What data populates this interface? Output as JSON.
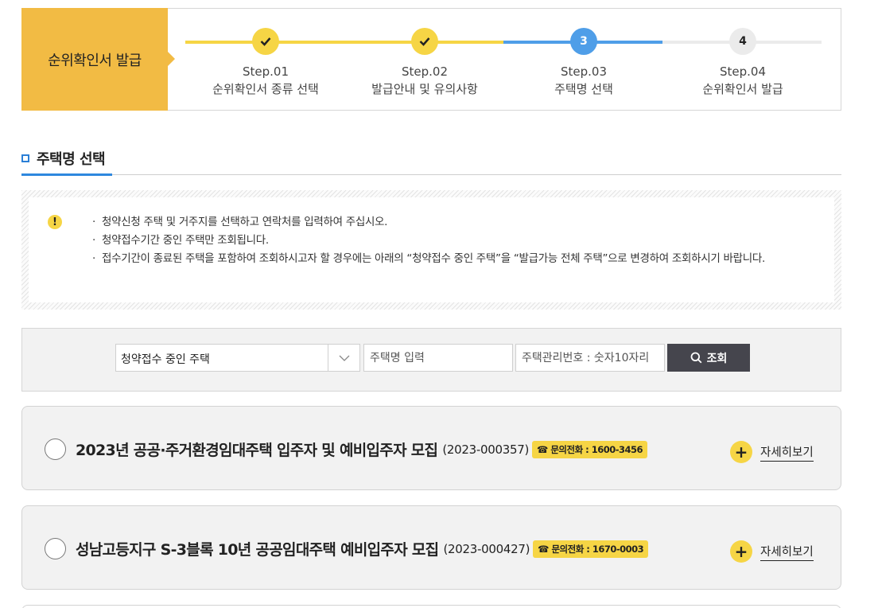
{
  "stepper": {
    "title": "순위확인서 발급",
    "steps": [
      {
        "num": "1",
        "step": "Step.01",
        "label": "순위확인서 종류 선택",
        "status": "done"
      },
      {
        "num": "2",
        "step": "Step.02",
        "label": "발급안내 및 유의사항",
        "status": "done"
      },
      {
        "num": "3",
        "step": "Step.03",
        "label": "주택명 선택",
        "status": "current"
      },
      {
        "num": "4",
        "step": "Step.04",
        "label": "순위확인서 발급",
        "status": "todo"
      }
    ]
  },
  "section": {
    "title": "주택명 선택"
  },
  "notice": {
    "items": [
      "청약신청 주택 및 거주지를 선택하고 연락처를 입력하여 주십시오.",
      "청약접수기간 중인 주택만 조회됩니다.",
      "접수기간이 종료된 주택을 포함하여 조회하시고자 할 경우에는 아래의 “청약접수 중인 주택”을 “발급가능 전체 주택”으로 변경하여 조회하시기 바랍니다."
    ]
  },
  "search": {
    "select_value": "청약접수 중인 주택",
    "name_placeholder": "주택명 입력",
    "code_placeholder": "주택관리번호 : 숫자10자리",
    "button_label": "조회"
  },
  "results": [
    {
      "name": "2023년 공공·주거환경임대주택 입주자 및 예비입주자 모집",
      "code": "(2023-000357)",
      "phone": "☎ 문의전화 : 1600-3456",
      "detail_label": "자세히보기"
    },
    {
      "name": "성남고등지구 S-3블록 10년 공공임대주택 예비입주자 모집",
      "code": "(2023-000427)",
      "phone": "☎ 문의전화 : 1670-0003",
      "detail_label": "자세히보기"
    }
  ],
  "colors": {
    "accent_yellow": "#f2bb44",
    "step_done": "#f6d545",
    "step_current": "#4f9ee8",
    "section_accent": "#2e88de",
    "search_button": "#45454d"
  }
}
